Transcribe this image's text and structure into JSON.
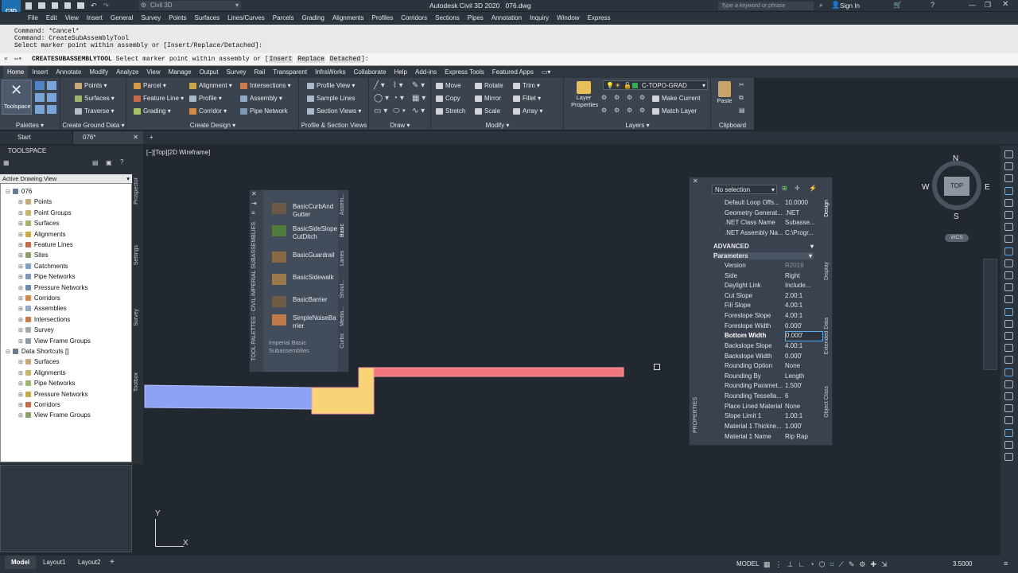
{
  "app": {
    "title": "Autodesk Civil 3D 2020",
    "file": "076.dwg",
    "workspace": "Civil 3D",
    "search_placeholder": "Type a keyword or phrase",
    "sign_in": "Sign In",
    "logo": "C3D"
  },
  "menu": [
    "File",
    "Edit",
    "View",
    "Insert",
    "General",
    "Survey",
    "Points",
    "Surfaces",
    "Lines/Curves",
    "Parcels",
    "Grading",
    "Alignments",
    "Profiles",
    "Corridors",
    "Sections",
    "Pipes",
    "Annotation",
    "Inquiry",
    "Window",
    "Express"
  ],
  "command": {
    "history": [
      "Command: *Cancel*",
      "Command: CreateSubAssemblyTool",
      "Select marker point within assembly or [Insert/Replace/Detached]:"
    ],
    "prompt_cmd": "CREATESUBASSEMBLYTOOL",
    "prompt_text": "Select marker point within assembly or [",
    "opt_insert": "Insert",
    "opt_replace": "Replace",
    "opt_detached": "Detached",
    "prompt_end": "]:"
  },
  "ribbon_tabs": [
    "Home",
    "Insert",
    "Annotate",
    "Modify",
    "Analyze",
    "View",
    "Manage",
    "Output",
    "Survey",
    "Rail",
    "Transparent",
    "InfraWorks",
    "Collaborate",
    "Help",
    "Add-ins",
    "Express Tools",
    "Featured Apps"
  ],
  "ribbon": {
    "toolspace": "Toolspace",
    "palettes": "Palettes",
    "ground": {
      "title": "Create Ground Data",
      "items": [
        "Points",
        "Surfaces",
        "Traverse"
      ]
    },
    "design": {
      "title": "Create Design",
      "col1": [
        "Parcel",
        "Feature Line",
        "Grading"
      ],
      "col2": [
        "Alignment",
        "Profile",
        "Corridor"
      ],
      "col3": [
        "Intersections",
        "Assembly",
        "Pipe Network"
      ]
    },
    "profile": {
      "title": "Profile & Section Views",
      "items": [
        "Profile View",
        "Sample Lines",
        "Section Views"
      ]
    },
    "draw": {
      "title": "Draw"
    },
    "modify": {
      "title": "Modify",
      "col1": [
        "Move",
        "Copy",
        "Stretch"
      ],
      "col2": [
        "Rotate",
        "Mirror",
        "Scale"
      ],
      "col3": [
        "Trim",
        "Fillet",
        "Array"
      ]
    },
    "layers": {
      "title": "Layers",
      "layer_props": "Layer Properties",
      "current_layer": "C-TOPO-GRAD",
      "make_current": "Make Current",
      "match_layer": "Match Layer"
    },
    "clipboard": {
      "title": "Clipboard",
      "paste": "Paste"
    }
  },
  "doc_tabs": [
    "Start",
    "076*"
  ],
  "viewport_label": "[−][Top][2D Wireframe]",
  "toolspace": {
    "title": "TOOLSPACE",
    "view": "Active Drawing View",
    "tree": [
      {
        "label": "076",
        "level": 0
      },
      {
        "label": "Points",
        "level": 1
      },
      {
        "label": "Point Groups",
        "level": 1
      },
      {
        "label": "Surfaces",
        "level": 1
      },
      {
        "label": "Alignments",
        "level": 1
      },
      {
        "label": "Feature Lines",
        "level": 1
      },
      {
        "label": "Sites",
        "level": 1
      },
      {
        "label": "Catchments",
        "level": 1
      },
      {
        "label": "Pipe Networks",
        "level": 1
      },
      {
        "label": "Pressure Networks",
        "level": 1
      },
      {
        "label": "Corridors",
        "level": 1
      },
      {
        "label": "Assemblies",
        "level": 1
      },
      {
        "label": "Intersections",
        "level": 1
      },
      {
        "label": "Survey",
        "level": 1
      },
      {
        "label": "View Frame Groups",
        "level": 1
      },
      {
        "label": "Data Shortcuts []",
        "level": 0
      },
      {
        "label": "Surfaces",
        "level": 1
      },
      {
        "label": "Alignments",
        "level": 1
      },
      {
        "label": "Pipe Networks",
        "level": 1
      },
      {
        "label": "Pressure Networks",
        "level": 1
      },
      {
        "label": "Corridors",
        "level": 1
      },
      {
        "label": "View Frame Groups",
        "level": 1
      }
    ],
    "side_tabs": [
      "Prospector",
      "Settings",
      "Survey",
      "Toolbox"
    ]
  },
  "palette": {
    "title": "TOOL PALETTES - CIVIL IMPERIAL SUBASSEMBLIES",
    "items": [
      {
        "l1": "BasicCurbAnd",
        "l2": "Gutter"
      },
      {
        "l1": "BasicSideSlope",
        "l2": "CutDitch"
      },
      {
        "l1": "BasicGuardrail",
        "l2": ""
      },
      {
        "l1": "BasicSidewalk",
        "l2": ""
      },
      {
        "l1": "BasicBarrier",
        "l2": ""
      },
      {
        "l1": "SimpleNoiseBa",
        "l2": "rrier"
      }
    ],
    "footer1": "Imperial Basic",
    "footer2": "Subassemblies",
    "tabs": [
      "Assem...",
      "Basic",
      "Lanes",
      "Shoul...",
      "Media...",
      "Curbs"
    ]
  },
  "properties": {
    "title": "PROPERTIES",
    "selection": "No selection",
    "top_rows": [
      {
        "k": "Default Loop Offs...",
        "v": "10.0000"
      },
      {
        "k": "Geometry Generat...",
        "v": ".NET"
      },
      {
        "k": ".NET Class Name",
        "v": "Subasse..."
      },
      {
        "k": ".NET Assembly Na...",
        "v": "C:\\Progr..."
      }
    ],
    "advanced": "ADVANCED",
    "parameters": "Parameters",
    "rows": [
      {
        "k": "Version",
        "v": "R2019"
      },
      {
        "k": "Side",
        "v": "Right"
      },
      {
        "k": "Daylight Link",
        "v": "Include..."
      },
      {
        "k": "Cut Slope",
        "v": "2.00:1"
      },
      {
        "k": "Fill Slope",
        "v": "4.00:1"
      },
      {
        "k": "Foreslope Slope",
        "v": "4.00:1"
      },
      {
        "k": "Foreslope Width",
        "v": "0.000'"
      },
      {
        "k": "Bottom Width",
        "v": "0.000'"
      },
      {
        "k": "Backslope Slope",
        "v": "4.00:1"
      },
      {
        "k": "Backslope Width",
        "v": "0.000'"
      },
      {
        "k": "Rounding Option",
        "v": "None"
      },
      {
        "k": "Rounding By",
        "v": "Length"
      },
      {
        "k": "Rounding  Paramet...",
        "v": "1.500'"
      },
      {
        "k": "Rounding  Tessella...",
        "v": "6"
      },
      {
        "k": "Place Lined Material",
        "v": "None"
      },
      {
        "k": "Slope Limit 1",
        "v": "1.00:1"
      },
      {
        "k": "Material 1  Thickne...",
        "v": "1.000'"
      },
      {
        "k": "Material 1 Name",
        "v": "Rip Rap"
      }
    ],
    "side_tabs": [
      "Design",
      "Display",
      "Extended Data",
      "Object Class"
    ]
  },
  "viewcube": {
    "n": "N",
    "s": "S",
    "e": "E",
    "w": "W",
    "face": "TOP",
    "wcs": "WCS"
  },
  "ucs": {
    "x": "X",
    "y": "Y"
  },
  "layout_tabs": [
    "Model",
    "Layout1",
    "Layout2"
  ],
  "status": {
    "model": "MODEL",
    "scale": "3.5000"
  },
  "colors": {
    "blue": "#8da2f5",
    "yellow": "#f8d477",
    "red": "#f1757f",
    "canvas": "#212830"
  }
}
